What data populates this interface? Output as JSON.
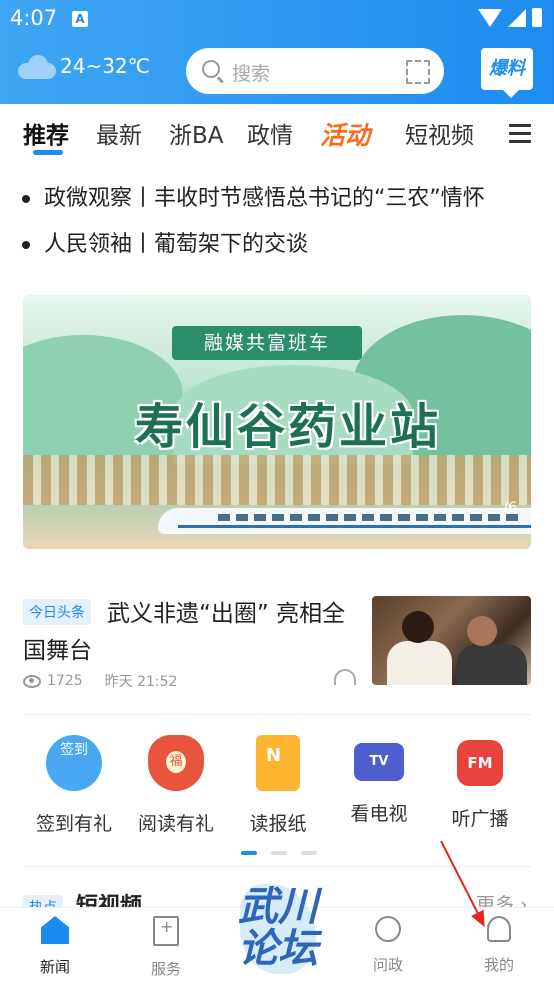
{
  "status_bar": {
    "time": "4:07",
    "notif_icon": "A"
  },
  "header": {
    "weather": "24~32℃",
    "search_placeholder": "搜索",
    "baoliao_label": "爆料"
  },
  "tabs": [
    "推荐",
    "最新",
    "浙BA",
    "政情",
    "活动",
    "短视频"
  ],
  "headlines": [
    "政微观察丨丰收时节感悟总书记的“三农”情怀",
    "人民领袖丨葡萄架下的交谈"
  ],
  "banner": {
    "tag": "融媒共富班车",
    "title": "寿仙谷药业站",
    "indicator": "/6"
  },
  "news": {
    "tag": "今日头条",
    "title": "武义非遗“出圈” 亮相全国舞台",
    "views": "1725",
    "time": "昨天 21:52"
  },
  "services": [
    {
      "label": "签到有礼",
      "icon": "签到",
      "icon_name": "checkin-icon"
    },
    {
      "label": "阅读有礼",
      "icon": "福",
      "icon_name": "lucky-bag-icon"
    },
    {
      "label": "读报纸",
      "icon": "N",
      "icon_name": "newspaper-icon"
    },
    {
      "label": "看电视",
      "icon": "TV",
      "icon_name": "tv-icon"
    },
    {
      "label": "听广播",
      "icon": "FM",
      "icon_name": "radio-icon"
    }
  ],
  "section": {
    "tag": "热点",
    "title": "短视频",
    "more": "更多"
  },
  "bottom_nav": [
    {
      "label": "新闻",
      "active": true
    },
    {
      "label": "服务",
      "active": false
    },
    {
      "label": "问政",
      "active": false
    },
    {
      "label": "我的",
      "active": false
    }
  ],
  "logo_text": "武川论坛",
  "colors": {
    "accent": "#1d8cf0",
    "activity": "#ff6a1a",
    "annotation": "#e3271f"
  }
}
